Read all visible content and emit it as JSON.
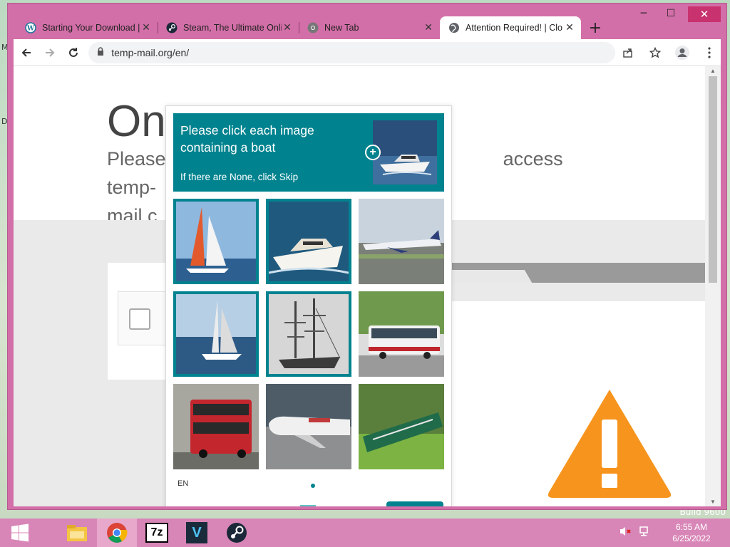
{
  "browser": {
    "tabs": [
      {
        "title": "Starting Your Download |",
        "favicon": "wordpress-icon",
        "active": false
      },
      {
        "title": "Steam, The Ultimate Onli",
        "favicon": "steam-icon",
        "active": false
      },
      {
        "title": "New Tab",
        "favicon": "chrome-icon",
        "active": false
      },
      {
        "title": "Attention Required! | Clo",
        "favicon": "globe-icon",
        "active": true
      }
    ],
    "new_tab_label": "+",
    "url": "temp-mail.org/en/",
    "window_controls": {
      "minimize": "─",
      "maximize": "☐",
      "close": "✕"
    }
  },
  "page": {
    "heading": "On",
    "subtitle_left": "Please",
    "subtitle_right": "access temp-",
    "subtitle_line2": "mail.c"
  },
  "captcha": {
    "prompt": "Please click each image containing a boat",
    "hint": "If there are None, click Skip",
    "plus": "+",
    "lang": "EN",
    "tiles": [
      {
        "subject": "sailboat",
        "selected": true
      },
      {
        "subject": "motor yacht",
        "selected": true
      },
      {
        "subject": "airplane",
        "selected": false
      },
      {
        "subject": "sailboat",
        "selected": true
      },
      {
        "subject": "tall ship",
        "selected": true
      },
      {
        "subject": "bus",
        "selected": false
      },
      {
        "subject": "double-decker bus",
        "selected": false
      },
      {
        "subject": "airplane",
        "selected": false
      },
      {
        "subject": "train",
        "selected": false
      }
    ]
  },
  "taskbar": {
    "apps": [
      "file-explorer-icon",
      "chrome-icon",
      "7zip-icon",
      "vim-icon",
      "steam-icon"
    ],
    "sevenzip_label": "7z",
    "v_label": "V",
    "time": "6:55 AM",
    "date": "6/25/2022"
  },
  "desktop": {
    "build_text": "Build 9600",
    "edge_letters": [
      "M",
      "D"
    ]
  },
  "colors": {
    "frame": "#d36fa8",
    "captcha_teal": "#00838f",
    "warning_orange": "#f7941d",
    "taskbar": "#d886b7"
  }
}
